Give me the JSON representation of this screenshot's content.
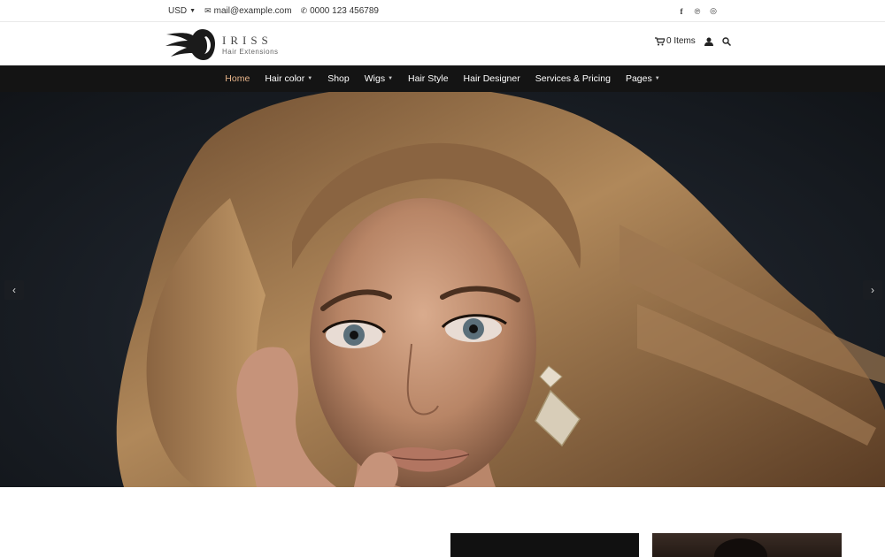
{
  "topbar": {
    "currency": "USD",
    "email": "mail@example.com",
    "phone": "0000 123 456789",
    "social_icons": [
      "facebook-icon",
      "pinterest-icon",
      "instagram-icon"
    ]
  },
  "header": {
    "logo_title": "IRISS",
    "logo_subtitle": "Hair Extensions",
    "cart_label": "0 Items"
  },
  "nav": {
    "items": [
      {
        "label": "Home",
        "active": true,
        "dropdown": false
      },
      {
        "label": "Hair color",
        "active": false,
        "dropdown": true
      },
      {
        "label": "Shop",
        "active": false,
        "dropdown": false
      },
      {
        "label": "Wigs",
        "active": false,
        "dropdown": true
      },
      {
        "label": "Hair Style",
        "active": false,
        "dropdown": false
      },
      {
        "label": "Hair Designer",
        "active": false,
        "dropdown": false
      },
      {
        "label": "Services & Pricing",
        "active": false,
        "dropdown": false
      },
      {
        "label": "Pages",
        "active": false,
        "dropdown": true
      }
    ]
  },
  "hero": {
    "prev_icon": "chevron-left-icon",
    "next_icon": "chevron-right-icon"
  },
  "colors": {
    "nav_bg": "#141414",
    "active_accent": "#e7b48a"
  }
}
